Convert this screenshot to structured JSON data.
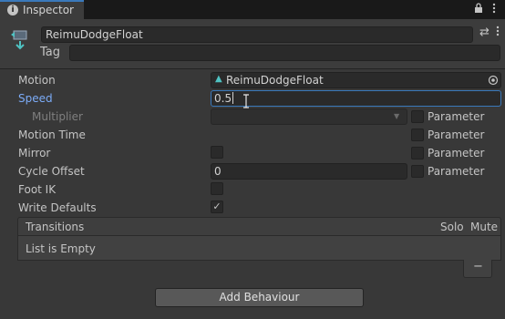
{
  "window": {
    "tab_title": "Inspector",
    "lock_icon": "lock-icon",
    "menu_icon": "kebab-menu-icon"
  },
  "header": {
    "object_name": "ReimuDodgeFloat",
    "tag_label": "Tag",
    "tag_value": ""
  },
  "properties": {
    "motion": {
      "label": "Motion",
      "value": "ReimuDodgeFloat"
    },
    "speed": {
      "label": "Speed",
      "value": "0.5"
    },
    "multiplier": {
      "label": "Multiplier",
      "value": "",
      "param_label": "Parameter"
    },
    "motion_time": {
      "label": "Motion Time",
      "param_label": "Parameter"
    },
    "mirror": {
      "label": "Mirror",
      "param_label": "Parameter"
    },
    "cycle_offset": {
      "label": "Cycle Offset",
      "value": "0",
      "param_label": "Parameter"
    },
    "foot_ik": {
      "label": "Foot IK"
    },
    "write_defaults": {
      "label": "Write Defaults",
      "check": "✓"
    }
  },
  "transitions": {
    "title": "Transitions",
    "col_solo": "Solo",
    "col_mute": "Mute",
    "empty_text": "List is Empty",
    "remove_label": "−"
  },
  "footer": {
    "add_behaviour_label": "Add Behaviour"
  },
  "colors": {
    "accent": "#3a79bb",
    "speed_label": "#7cacf8",
    "background": "#383838"
  }
}
